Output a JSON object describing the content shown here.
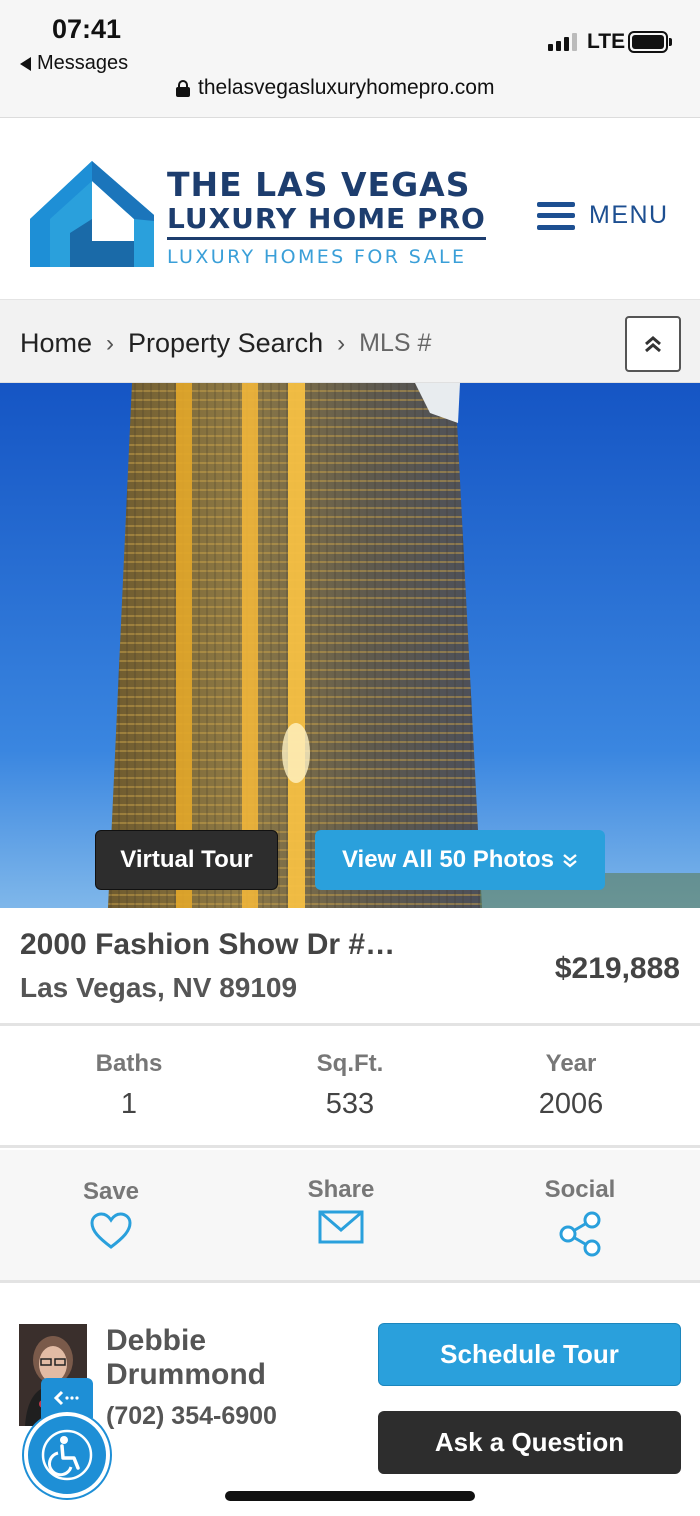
{
  "status_bar": {
    "time": "07:41",
    "back_app": "Messages",
    "network": "LTE",
    "url": "thelasvegasluxuryhomepro.com"
  },
  "header": {
    "logo": {
      "line1": "THE LAS VEGAS",
      "line2": "LUXURY HOME PRO",
      "tagline": "LUXURY HOMES FOR SALE"
    },
    "menu_label": "MENU"
  },
  "breadcrumb": {
    "items": [
      "Home",
      "Property Search",
      "MLS #"
    ]
  },
  "hero": {
    "virtual_tour_label": "Virtual Tour",
    "view_photos_label": "View All 50 Photos"
  },
  "listing": {
    "address_line1": "2000 Fashion Show Dr #…",
    "address_line2": "Las Vegas, NV 89109",
    "price": "$219,888"
  },
  "stats": [
    {
      "label": "Baths",
      "value": "1"
    },
    {
      "label": "Sq.Ft.",
      "value": "533"
    },
    {
      "label": "Year",
      "value": "2006"
    }
  ],
  "actions": {
    "save": "Save",
    "share": "Share",
    "social": "Social"
  },
  "agent": {
    "name": "Debbie Drummond",
    "phone": "(702) 354-6900",
    "schedule_label": "Schedule Tour",
    "ask_label": "Ask a Question"
  },
  "colors": {
    "brand_navy": "#1d3d6e",
    "brand_blue": "#2aa0dc",
    "dark_button": "#2d2d2d"
  }
}
